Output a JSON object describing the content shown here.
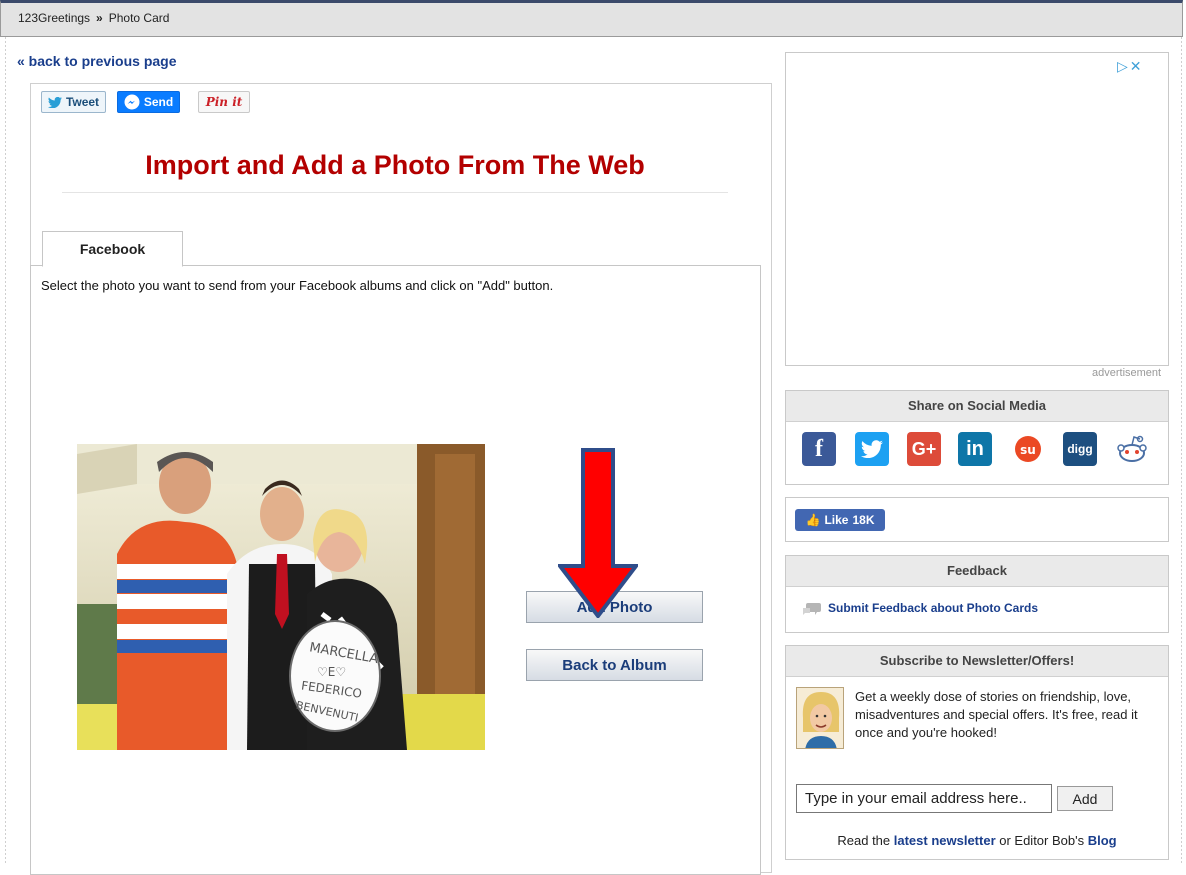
{
  "breadcrumb": {
    "site": "123Greetings",
    "separator": "»",
    "current": "Photo Card"
  },
  "back_link": "« back to previous page",
  "share": {
    "tweet": "Tweet",
    "send": "Send",
    "pin": "Pin it"
  },
  "page_title": "Import and Add a Photo From The Web",
  "tab": {
    "label": "Facebook"
  },
  "instructions": "Select the photo you want to send from your Facebook albums and click on \"Add\" button.",
  "buttons": {
    "add_photo": "Add Photo",
    "back_to_album": "Back to Album"
  },
  "sidebar": {
    "ad_label": "advertisement",
    "social_heading": "Share on Social Media",
    "social_icons": [
      "facebook-icon",
      "twitter-icon",
      "google-plus-icon",
      "linkedin-icon",
      "stumbleupon-icon",
      "digg-icon",
      "reddit-icon"
    ],
    "like": {
      "label": "Like",
      "count": "18K"
    },
    "feedback_heading": "Feedback",
    "feedback_link": "Submit Feedback about Photo Cards",
    "newsletter_heading": "Subscribe to Newsletter/Offers!",
    "newsletter_text": "Get a weekly dose of stories on friendship, love, misadventures and special offers. It's free, read it once and you're hooked!",
    "email_placeholder": "Type in your email address here..",
    "email_add": "Add",
    "footer": {
      "pre": "Read the ",
      "newsletter_link": "latest newsletter",
      "mid": " or Editor Bob's ",
      "blog_link": "Blog"
    }
  },
  "colors": {
    "title": "#b30000",
    "link": "#1a3e8c",
    "arrow": "#ff0000",
    "arrow_outline": "#2f4d8a"
  }
}
